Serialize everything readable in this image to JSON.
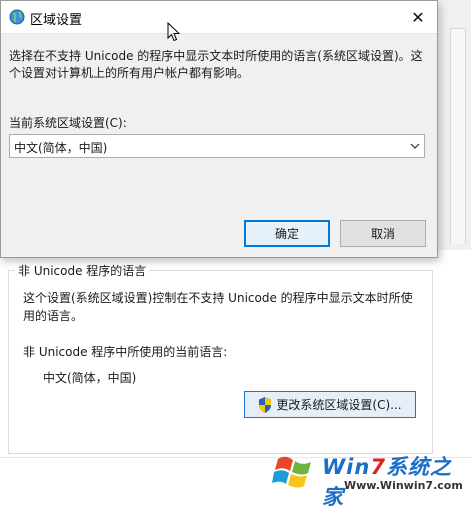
{
  "background_window": {
    "group": {
      "legend": "非 Unicode 程序的语言",
      "description": "这个设置(系统区域设置)控制在不支持 Unicode 的程序中显示文本时所使用的语言。",
      "current_label": "非 Unicode 程序中所使用的当前语言:",
      "current_value": "中文(简体，中国)",
      "change_button_label": "更改系统区域设置(C)..."
    }
  },
  "dialog": {
    "title": "区域设置",
    "close_glyph": "✕",
    "description": "选择在不支持 Unicode 的程序中显示文本时所使用的语言(系统区域设置)。这个设置对计算机上的所有用户帐户都有影响。",
    "locale_label": "当前系统区域设置(C):",
    "locale_selected": "中文(简体，中国)",
    "ok_label": "确定",
    "cancel_label": "取消"
  },
  "watermark": {
    "brand_prefix": "Win",
    "brand_seven": "7",
    "brand_suffix": "系统之家",
    "url": "Www.Winwin7.com"
  },
  "icons": {
    "title": "globe-icon",
    "close": "close-icon",
    "select_arrow": "chevron-down-icon",
    "uac": "uac-shield-icon",
    "cursor": "mouse-cursor-icon",
    "watermark_logo": "windows-logo-icon"
  },
  "colors": {
    "accent_blue": "#0078d7",
    "dialog_bg": "#f0f0f0",
    "brand_blue": "#1c6fc5",
    "brand_red": "#d9261c"
  }
}
